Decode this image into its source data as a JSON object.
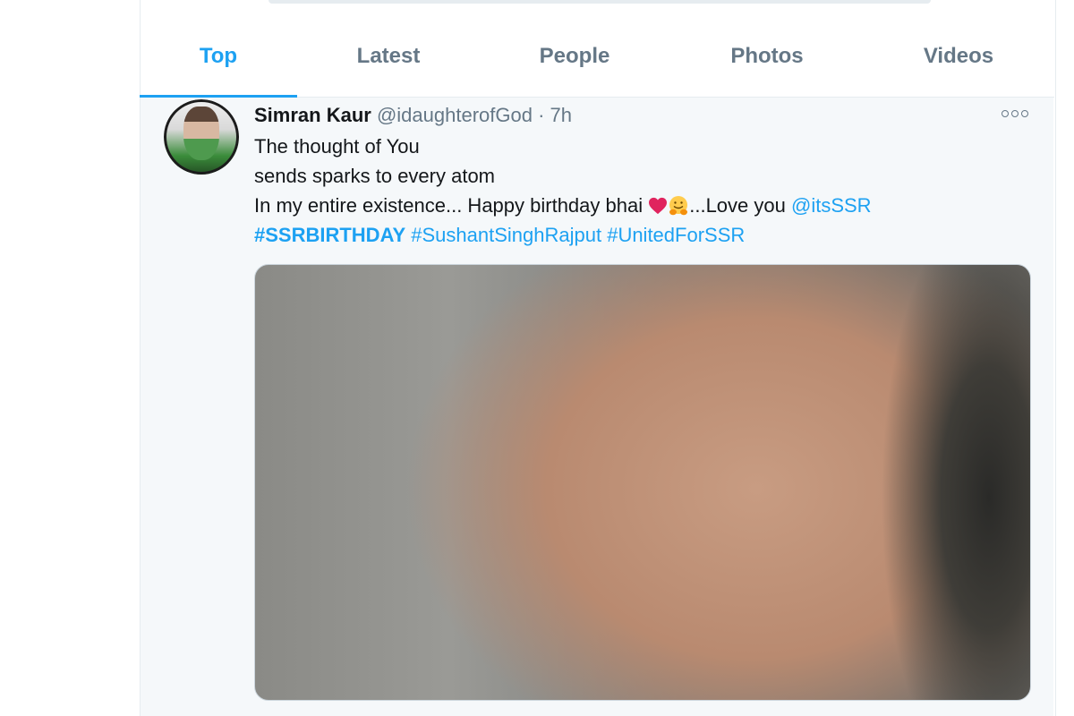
{
  "tabs": [
    {
      "label": "Top",
      "active": true
    },
    {
      "label": "Latest",
      "active": false
    },
    {
      "label": "People",
      "active": false
    },
    {
      "label": "Photos",
      "active": false
    },
    {
      "label": "Videos",
      "active": false
    }
  ],
  "tweet": {
    "author_name": "Simran Kaur",
    "author_handle": "@idaughterofGod",
    "separator": "·",
    "timestamp": "7h",
    "more_icon": "more-horizontal-icon",
    "text": {
      "line1": "The thought of You",
      "line2": "sends sparks to every atom",
      "line3_before": "In my entire existence... Happy birthday bhai ",
      "line3_emojis": [
        "red-heart-emoji",
        "hugging-face-emoji"
      ],
      "line3_after": "...Love you ",
      "mention": "@itsSSR",
      "hashtags": [
        "#SSRBIRTHDAY",
        "#SushantSinghRajput",
        "#UnitedForSSR"
      ]
    },
    "media": {
      "type": "photo"
    }
  },
  "colors": {
    "accent": "#1da1f2",
    "text_primary": "#14171a",
    "text_secondary": "#657786",
    "tweet_background": "#f5f8fa",
    "border": "#e6ecf0",
    "heart": "#e0245e"
  }
}
